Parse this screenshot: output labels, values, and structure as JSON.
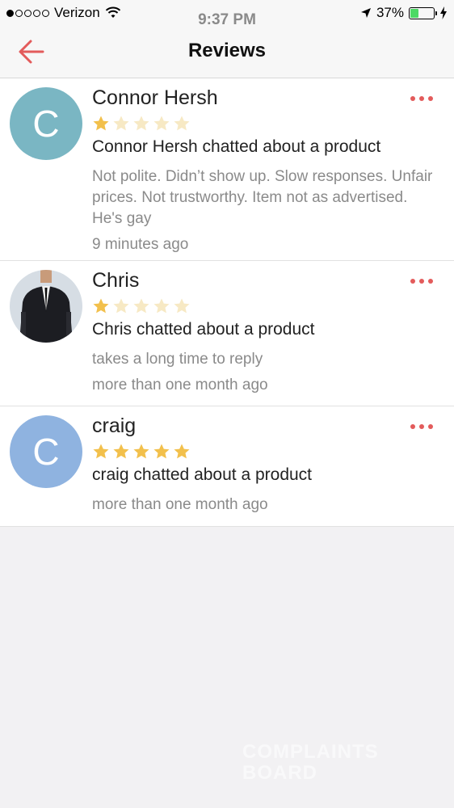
{
  "status_bar": {
    "carrier": "Verizon",
    "time": "9:37 PM",
    "battery": "37%",
    "battery_level": 0.37
  },
  "header": {
    "title": "Reviews"
  },
  "reviews": [
    {
      "avatar_letter": "C",
      "avatar_color": "#7ab6c3",
      "name": "Connor Hersh",
      "rating": 1,
      "headline": "Connor Hersh chatted about a product",
      "text": "Not polite. Didn’t show up. Slow responses. Unfair prices. Not trustworthy. Item not as advertised. He's gay",
      "time": "9 minutes ago"
    },
    {
      "avatar_letter": "",
      "avatar_color": "#2c3a4a",
      "name": "Chris",
      "rating": 1,
      "headline": "Chris chatted about a product",
      "text": "takes a long time to reply",
      "time": "more than one month ago"
    },
    {
      "avatar_letter": "C",
      "avatar_color": "#8fb3e0",
      "name": "craig",
      "rating": 5,
      "headline": "craig chatted about a product",
      "text": "",
      "time": "more than one month ago"
    }
  ],
  "watermark": {
    "line1": "COMPLAINTS",
    "line2": "BOARD"
  },
  "colors": {
    "accent": "#e35b5b",
    "star_filled": "#f2c04c",
    "star_empty": "#f7e9c4"
  }
}
